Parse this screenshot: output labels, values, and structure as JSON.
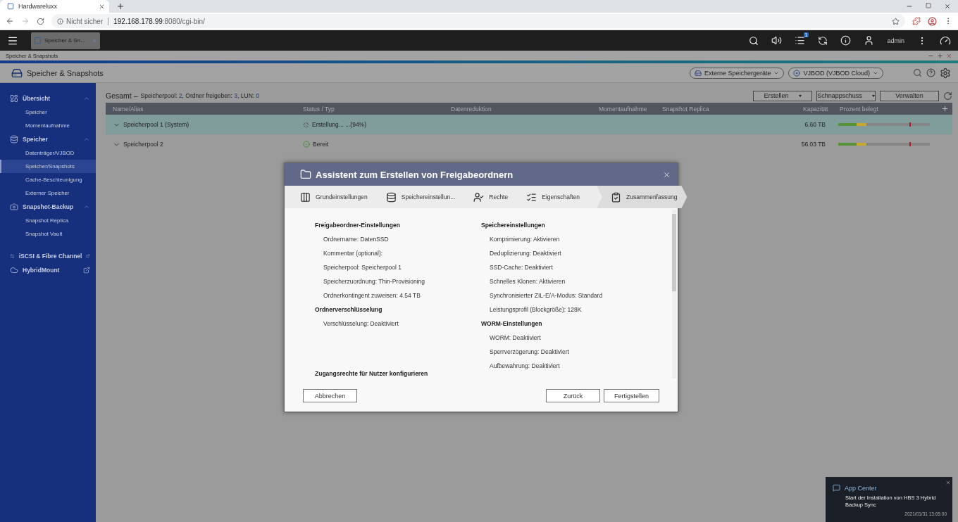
{
  "browser": {
    "tab_title": "Hardwareluxx",
    "warning": "Nicht sicher",
    "url_host": "192.168.178.99",
    "url_path": ":8080/cgi-bin/"
  },
  "topbar": {
    "app_tab": "Speicher & Sn...",
    "task_badge": "1",
    "user": "admin"
  },
  "window_title": "Speicher & Snapshots",
  "app": {
    "title": "Speicher & Snapshots",
    "header_buttons": [
      "Externe Speichergeräte",
      "VJBOD (VJBOD Cloud)"
    ]
  },
  "sidebar": [
    {
      "label": "Übersicht",
      "expanded": true,
      "children": [
        {
          "label": "Speicher",
          "selected": false
        },
        {
          "label": "Momentaufnahme",
          "selected": false
        }
      ]
    },
    {
      "label": "Speicher",
      "expanded": true,
      "children": [
        {
          "label": "Datenträger/VJBOD",
          "selected": false
        },
        {
          "label": "Speicher/Snapshots",
          "selected": true
        },
        {
          "label": "Cache-Beschleunigung",
          "selected": false
        },
        {
          "label": "Externer Speicher",
          "selected": false
        }
      ]
    },
    {
      "label": "Snapshot-Backup",
      "expanded": true,
      "children": [
        {
          "label": "Snapshot Replica",
          "selected": false
        },
        {
          "label": "Snapshot Vault",
          "selected": false
        }
      ]
    }
  ],
  "external_links": [
    "iSCSI & Fibre Channel",
    "HybridMount"
  ],
  "summary": {
    "label": "Gesamt –",
    "parts": [
      {
        "kind": "label",
        "text": "Speicherpool: "
      },
      {
        "kind": "value",
        "text": "2"
      },
      {
        "kind": "label",
        "text": ", Ordner freigeben: "
      },
      {
        "kind": "value",
        "text": "3"
      },
      {
        "kind": "label",
        "text": ", LUN: "
      },
      {
        "kind": "value",
        "text": "0"
      }
    ]
  },
  "actions": [
    {
      "label": "Erstellen"
    },
    {
      "label": "Schnappschuss"
    },
    {
      "label": "Verwalten"
    }
  ],
  "table": {
    "columns": [
      "Name/Alias",
      "Status / Typ",
      "Datenreduktion",
      "Momentaufnahme",
      "Snapshot Replica",
      "Kapazität",
      "Prozent belegt"
    ],
    "rows": [
      {
        "name": "Speicherpool 1 (System)",
        "status": "Erstellung... ...(94%)",
        "kind": "progress",
        "capacity": "6.60 TB",
        "level": 0.31,
        "selected": true
      },
      {
        "name": "Speicherpool 2",
        "status": "Bereit",
        "kind": "ready",
        "capacity": "56.03 TB",
        "level": 0.31,
        "selected": false
      }
    ]
  },
  "dialog": {
    "title": "Assistent zum Erstellen von Freigabeordnern",
    "steps": [
      {
        "label": "Grundeinstellungen",
        "selected": false
      },
      {
        "label": "Speichereinstellun...",
        "selected": false
      },
      {
        "label": "Rechte",
        "selected": false
      },
      {
        "label": "Eigenschaften",
        "selected": false
      },
      {
        "label": "Zusammenfassung",
        "selected": true
      }
    ],
    "columns": [
      [
        {
          "heading": "Freigabeordner-Einstellungen",
          "items": [
            "Ordnername: DatenSSD",
            "Kommentar (optional):",
            "Speicherpool: Speicherpool 1",
            "Speicherzuordnung: Thin-Provisioning",
            "Ordnerkontingent zuweisen: 4.54 TB"
          ]
        },
        {
          "heading": "Ordnerverschlüsselung",
          "items": [
            "Verschlüsselung: Deaktiviert"
          ]
        }
      ],
      [
        {
          "heading": "Speichereinstellungen",
          "items": [
            "Komprimierung: Aktivieren",
            "Deduplizierung: Deaktiviert",
            "SSD-Cache: Deaktiviert",
            "Schnelles Klonen: Aktivieren",
            "Synchronisierter ZIL-E/A-Modus: Standard",
            "Leistungsprofil (Blockgröße): 128K"
          ]
        },
        {
          "heading": "WORM-Einstellungen",
          "items": [
            "WORM: Deaktiviert",
            "Sperrverzögerung: Deaktiviert",
            "Aufbewahrung: Deaktiviert"
          ]
        }
      ]
    ],
    "next_heading": "Zugangsrechte für Nutzer konfigurieren",
    "cancel": "Abbrechen",
    "back": "Zurück",
    "finish": "Fertigstellen"
  },
  "notification": {
    "app": "App Center",
    "message": "Start der Installation von HBS 3 Hybrid Backup Sync",
    "time": "2021/01/31 13:05:00"
  }
}
